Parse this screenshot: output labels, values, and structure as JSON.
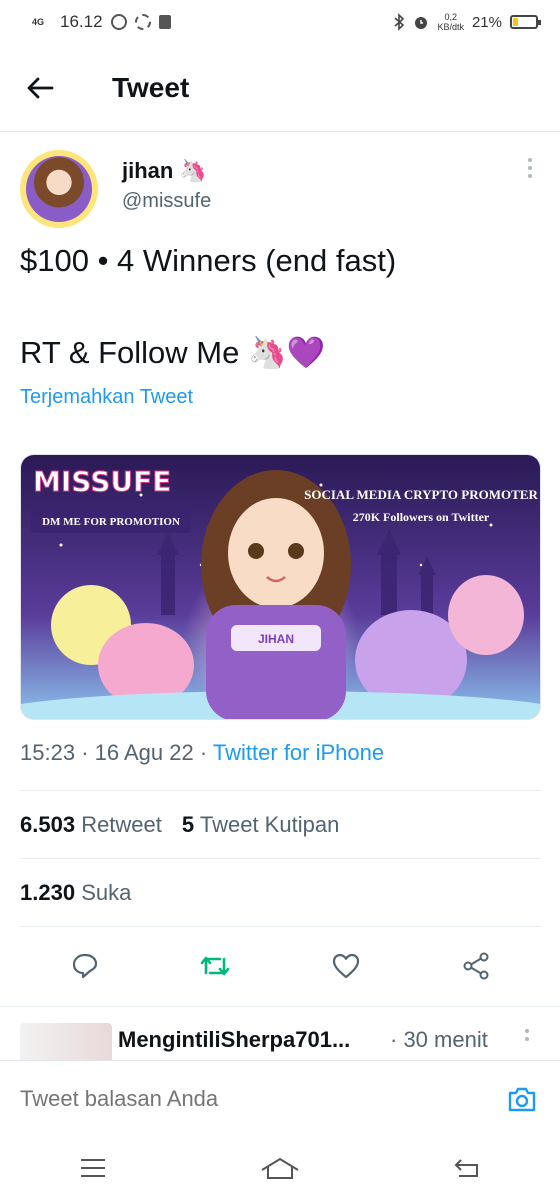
{
  "status_bar": {
    "network": "4G",
    "time": "16.12",
    "data_speed_value": "0,2",
    "data_speed_unit": "KB/dtk",
    "battery": "21%",
    "battery_level": 0.21
  },
  "header": {
    "title": "Tweet"
  },
  "author": {
    "name": "jihan",
    "emoji": "🦄",
    "handle": "@missufe"
  },
  "tweet": {
    "line1": "$100 • 4 Winners (end fast)",
    "line2": "RT & Follow Me 🦄💜",
    "translate_label": "Terjemahkan Tweet"
  },
  "media": {
    "brand": "MISSUFE",
    "tagline_left": "DM ME FOR PROMOTION",
    "tagline_right_1": "SOCIAL MEDIA CRYPTO PROMOTER",
    "tagline_right_2": "270K Followers on Twitter",
    "banner_name": "JIHAN"
  },
  "meta": {
    "time": "15:23",
    "date": "16 Agu 22",
    "separator": "·",
    "source": "Twitter for iPhone"
  },
  "stats": {
    "retweets_count": "6.503",
    "retweets_label": "Retweet",
    "quotes_count": "5",
    "quotes_label": "Tweet Kutipan",
    "likes_count": "1.230",
    "likes_label": "Suka"
  },
  "reply_preview": {
    "name": "MengintiliSherpa701...",
    "time": "· 30 menit"
  },
  "composer": {
    "placeholder": "Tweet balasan Anda"
  },
  "colors": {
    "accent": "#1d9bf0",
    "retweet": "#00ba7c",
    "text": "#0f1419",
    "muted": "#536471"
  }
}
